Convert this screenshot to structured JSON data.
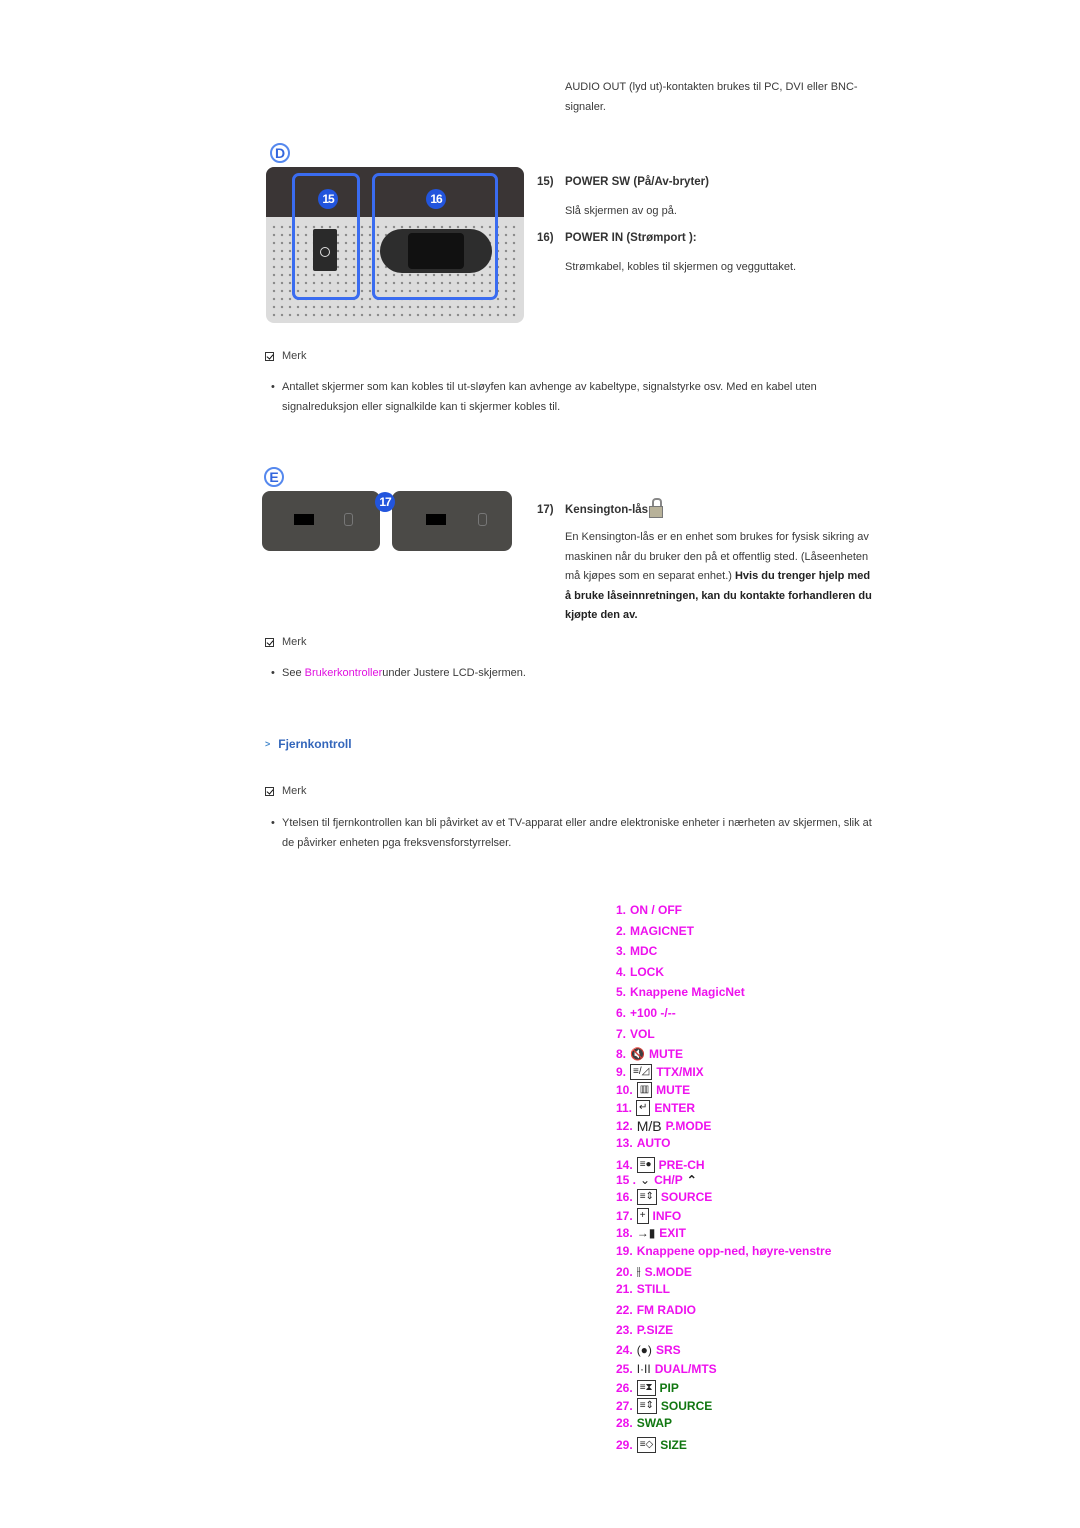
{
  "intro_text": "AUDIO OUT (lyd ut)-kontakten brukes til PC, DVI eller BNC-signaler.",
  "section_d": {
    "badge": "D",
    "photo_labels": [
      "15",
      "16"
    ],
    "items": [
      {
        "number": "15)",
        "title": "POWER SW (På/Av-bryter)",
        "desc": "Slå skjermen av og på."
      },
      {
        "number": "16)",
        "title": "POWER IN (Strømport ):",
        "desc": "Strømkabel, kobles til skjermen og vegguttaket."
      }
    ],
    "note_label": "Merk",
    "note_text": "Antallet skjermer som kan kobles til ut-sløyfen kan avhenge av kabeltype, signalstyrke osv. Med en kabel uten signalreduksjon eller signalkilde kan ti skjermer kobles til."
  },
  "section_e": {
    "badge": "E",
    "photo_label": "17",
    "item": {
      "number": "17)",
      "title": "Kensington-lås",
      "icon": "kensington-lock-icon",
      "desc": "En Kensington-lås er en enhet som brukes for fysisk sikring av maskinen når du bruker den på et offentlig sted. (Låseenheten må kjøpes som en separat enhet.)",
      "desc_bold": "Hvis du trenger hjelp med å bruke låseinnretningen, kan du kontakte forhandleren du kjøpte den av."
    },
    "note_label": "Merk",
    "note_prefix": "See ",
    "note_link": "Brukerkontroller",
    "note_suffix": "under Justere LCD-skjermen."
  },
  "remote_section": {
    "title": "Fjernkontroll",
    "note_label": "Merk",
    "note_text": "Ytelsen til fjernkontrollen kan bli påvirket av et TV-apparat eller andre elektroniske enheter i nærheten av skjermen, slik at de påvirker enheten pga freksvensforstyrrelser.",
    "buttons": [
      {
        "num": "1.",
        "label": "ON / OFF",
        "icon": null,
        "color": "magenta"
      },
      {
        "num": "2.",
        "label": "MAGICNET",
        "icon": null,
        "color": "magenta"
      },
      {
        "num": "3.",
        "label": "MDC",
        "icon": null,
        "color": "magenta"
      },
      {
        "num": "4.",
        "label": "LOCK",
        "icon": null,
        "color": "magenta"
      },
      {
        "num": "5.",
        "label": "Knappene MagicNet",
        "icon": null,
        "color": "magenta"
      },
      {
        "num": "6.",
        "label": "+100 -/--",
        "icon": null,
        "color": "magenta"
      },
      {
        "num": "7.",
        "label": "VOL",
        "icon": null,
        "color": "magenta"
      },
      {
        "num": "8.",
        "label": "MUTE",
        "icon": "mute-speaker-icon",
        "color": "magenta"
      },
      {
        "num": "9.",
        "label": "TTX/MIX",
        "icon": "teletext-mix-icon",
        "color": "magenta"
      },
      {
        "num": "10.",
        "label": "MUTE",
        "icon": "columns-icon",
        "color": "magenta"
      },
      {
        "num": "11.",
        "label": "ENTER",
        "icon": "enter-icon",
        "color": "magenta"
      },
      {
        "num": "12.",
        "label": "P.MODE",
        "icon": "mb-icon",
        "icon_text": "M/B",
        "color": "magenta"
      },
      {
        "num": "13.",
        "label": "AUTO",
        "icon": null,
        "color": "magenta"
      },
      {
        "num": "14.",
        "label": "PRE-CH",
        "icon": "pre-channel-icon",
        "color": "magenta"
      },
      {
        "num": "15 .",
        "label": "CH/P",
        "icon": "chevron-down-up-icon",
        "color": "magenta"
      },
      {
        "num": "16.",
        "label": "SOURCE",
        "icon": "source-icon",
        "color": "magenta"
      },
      {
        "num": "17.",
        "label": "INFO",
        "icon": "info-icon",
        "color": "magenta"
      },
      {
        "num": "18.",
        "label": "EXIT",
        "icon": "exit-door-icon",
        "color": "magenta"
      },
      {
        "num": "19.",
        "label": "Knappene opp-ned, høyre-venstre",
        "icon": null,
        "color": "magenta"
      },
      {
        "num": "20.",
        "label": "S.MODE",
        "icon": "sound-mode-icon",
        "color": "magenta"
      },
      {
        "num": "21.",
        "label": "STILL",
        "icon": null,
        "color": "magenta"
      },
      {
        "num": "22.",
        "label": "FM RADIO",
        "icon": null,
        "color": "magenta"
      },
      {
        "num": "23.",
        "label": "P.SIZE",
        "icon": null,
        "color": "magenta"
      },
      {
        "num": "24.",
        "label": "SRS",
        "icon": "srs-icon",
        "color": "magenta"
      },
      {
        "num": "25.",
        "label": "DUAL/MTS",
        "icon": "dual-icon",
        "color": "magenta"
      },
      {
        "num": "26.",
        "label": "PIP",
        "icon": "pip-icon",
        "color": "green"
      },
      {
        "num": "27.",
        "label": "SOURCE",
        "icon": "source-icon",
        "color": "green"
      },
      {
        "num": "28.",
        "label": "SWAP",
        "icon": null,
        "color": "green"
      },
      {
        "num": "29.",
        "label": "SIZE",
        "icon": "size-icon",
        "color": "green"
      }
    ]
  },
  "colors": {
    "magenta": "#ee11ee",
    "green": "#117711",
    "link": "#e010e0",
    "section_title": "#3366bb"
  }
}
